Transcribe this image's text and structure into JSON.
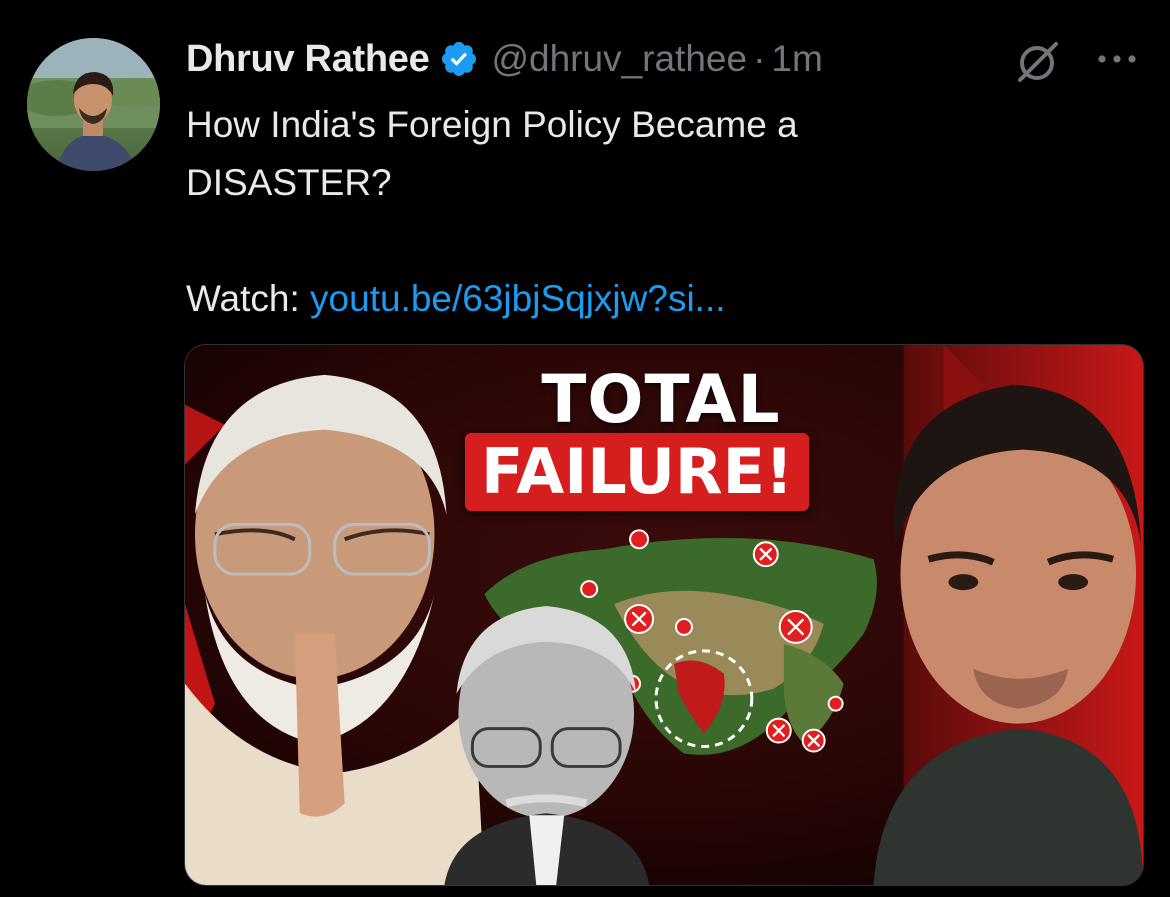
{
  "tweet": {
    "author_name": "Dhruv Rathee",
    "handle": "@dhruv_rathee",
    "separator": "·",
    "time": "1m",
    "text_line1": "How India's Foreign Policy Became a",
    "text_line2": "DISASTER?",
    "watch_label": "Watch: ",
    "link_text": "youtu.be/63jbjSqjxjw?si..."
  },
  "thumbnail": {
    "title": "TOTAL",
    "subtitle": "FAILURE!"
  },
  "colors": {
    "background": "#000000",
    "text_primary": "#e7e9ea",
    "text_secondary": "#71767b",
    "link": "#1d9bf0",
    "verified": "#1d9bf0",
    "thumbnail_red": "#d71e1e"
  },
  "icons": [
    "verified-badge-icon",
    "grok-icon",
    "more-icon"
  ]
}
